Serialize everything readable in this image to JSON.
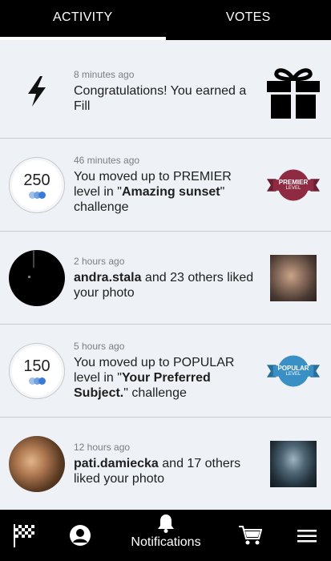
{
  "tabs": {
    "activity": "ACTIVITY",
    "votes": "VOTES"
  },
  "colors": {
    "dot_light": "#9fc0e8",
    "dot_dark": "#3a7ad8",
    "premier": "#8e2a42",
    "popular": "#3a8fc4"
  },
  "feed": [
    {
      "time": "8 minutes ago",
      "text": "Congratulations! You earned a Fill",
      "lead_icon": "lightning-bolt-icon",
      "trail_icon": "gift-box-icon"
    },
    {
      "time": "46 minutes ago",
      "text_before": "You moved up to PREMIER level in \"",
      "highlight": "Amazing sunset",
      "text_after": "\" challenge",
      "score": "250",
      "badge_title": "PREMIER",
      "badge_sub": "LEVEL"
    },
    {
      "time": "2 hours ago",
      "user": "andra.stala",
      "text": " and 23 others liked your photo"
    },
    {
      "time": "5 hours ago",
      "text_before": "You moved up to POPULAR level in \"",
      "highlight": "Your Preferred Subject.",
      "text_after": "\" challenge",
      "score": "150",
      "badge_title": "POPULAR",
      "badge_sub": "LEVEL"
    },
    {
      "time": "12 hours ago",
      "user": "pati.damiecka",
      "text": " and 17 others liked your photo"
    }
  ],
  "nav": {
    "notifications": "Notifications"
  }
}
